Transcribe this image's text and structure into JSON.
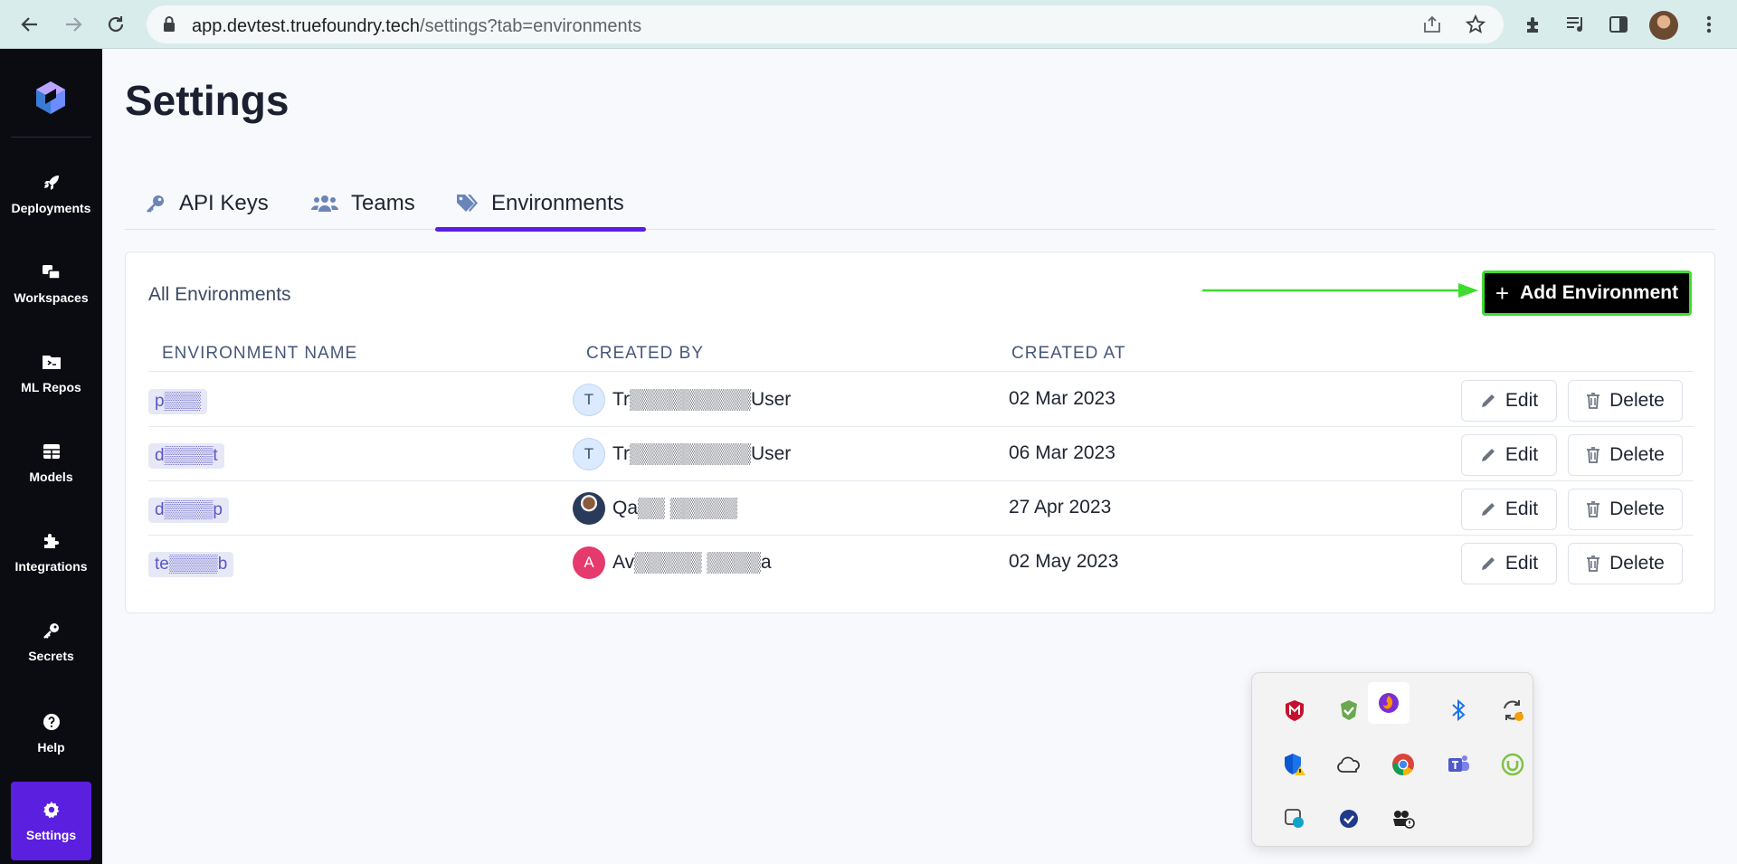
{
  "browser": {
    "url_host": "app.devtest.truefoundry.tech",
    "url_path": "/settings?tab=environments",
    "icons": [
      "back-icon",
      "forward-icon",
      "reload-icon",
      "lock-icon",
      "share-icon",
      "star-icon",
      "extensions-icon",
      "media-icon",
      "side-panel-icon",
      "profile-avatar",
      "menu-icon"
    ]
  },
  "sidebar": {
    "logo": "truefoundry-logo",
    "items": [
      {
        "label": "Deployments",
        "icon": "rocket-icon"
      },
      {
        "label": "Workspaces",
        "icon": "workspaces-icon"
      },
      {
        "label": "ML Repos",
        "icon": "folder-icon"
      },
      {
        "label": "Models",
        "icon": "table-icon"
      },
      {
        "label": "Integrations",
        "icon": "puzzle-icon"
      },
      {
        "label": "Secrets",
        "icon": "key-icon"
      },
      {
        "label": "Help",
        "icon": "help-icon"
      },
      {
        "label": "Settings",
        "icon": "gear-icon",
        "active": true
      }
    ]
  },
  "page": {
    "title": "Settings",
    "tabs": [
      {
        "label": "API Keys",
        "icon": "key-icon"
      },
      {
        "label": "Teams",
        "icon": "users-icon"
      },
      {
        "label": "Environments",
        "icon": "tags-icon",
        "active": true
      }
    ]
  },
  "environments": {
    "section_title": "All Environments",
    "add_button": "Add Environment",
    "columns": [
      "ENVIRONMENT NAME",
      "CREATED BY",
      "CREATED AT"
    ],
    "edit_label": "Edit",
    "delete_label": "Delete",
    "rows": [
      {
        "name": "p▒▒▒",
        "avatar_initial": "T",
        "avatar_style": "blue",
        "created_by": "Tr▒▒▒▒▒▒▒▒▒User",
        "created_at": "02 Mar 2023"
      },
      {
        "name": "d▒▒▒▒t",
        "avatar_initial": "T",
        "avatar_style": "blue",
        "created_by": "Tr▒▒▒▒▒▒▒▒▒User",
        "created_at": "06 Mar 2023"
      },
      {
        "name": "d▒▒▒▒p",
        "avatar_initial": "",
        "avatar_style": "photo",
        "created_by": "Qa▒▒ ▒▒▒▒▒",
        "created_at": "27 Apr 2023"
      },
      {
        "name": "te▒▒▒▒b",
        "avatar_initial": "A",
        "avatar_style": "pink",
        "created_by": "Av▒▒▒▒▒ ▒▒▒▒a",
        "created_at": "02 May 2023"
      }
    ]
  },
  "tray": {
    "icons": [
      "mcafee-icon",
      "security-check-icon",
      "firefox-icon",
      "bluetooth-icon",
      "sync-icon",
      "defender-warning-icon",
      "onedrive-icon",
      "chrome-icon",
      "teams-icon",
      "utorrent-icon",
      "snipping-icon",
      "task-check-icon",
      "webcam-icon"
    ]
  },
  "colors": {
    "accent": "#5b1fe0",
    "sidebar_bg": "#0b0b12",
    "highlight_green": "#3ddc2e"
  }
}
